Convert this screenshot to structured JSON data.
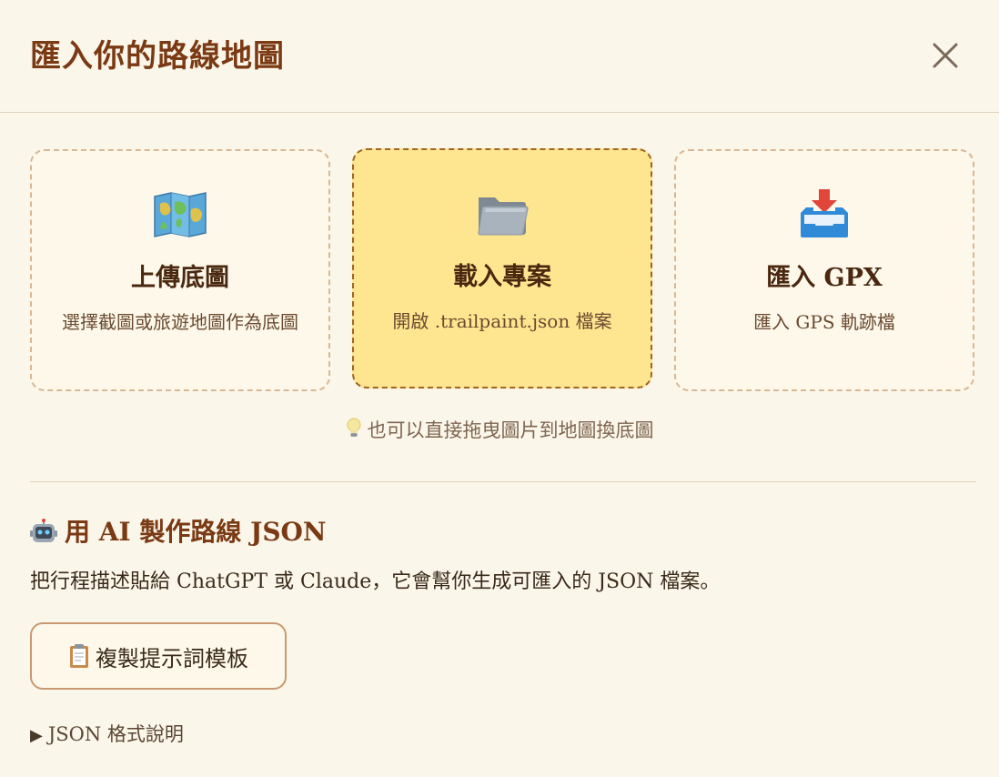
{
  "header": {
    "title": "匯入你的路線地圖",
    "close_icon": "close-icon"
  },
  "cards": [
    {
      "icon": "map-icon",
      "title": "上傳底圖",
      "desc": "選擇截圖或旅遊地圖作為底圖",
      "active": false
    },
    {
      "icon": "folder-icon",
      "title": "載入專案",
      "desc": "開啟 .trailpaint.json 檔案",
      "active": true
    },
    {
      "icon": "inbox-tray-icon",
      "title": "匯入 GPX",
      "desc": "匯入 GPS 軌跡檔",
      "active": false
    }
  ],
  "hint": {
    "icon": "lightbulb-icon",
    "text": "也可以直接拖曳圖片到地圖換底圖"
  },
  "ai_section": {
    "icon": "robot-icon",
    "heading": "用 AI 製作路線 JSON",
    "desc": "把行程描述貼給 ChatGPT 或 Claude，它會幫你生成可匯入的 JSON 檔案。",
    "copy_button": {
      "icon": "clipboard-icon",
      "label": "複製提示詞模板"
    },
    "json_toggle": {
      "icon": "triangle-right-icon",
      "label": "JSON 格式說明"
    }
  },
  "colors": {
    "background": "#fbf6ea",
    "title": "#7a3a14",
    "active_card": "#fee690",
    "card_border": "#d8b894",
    "active_border": "#a06424",
    "button_border": "#c99a72"
  }
}
